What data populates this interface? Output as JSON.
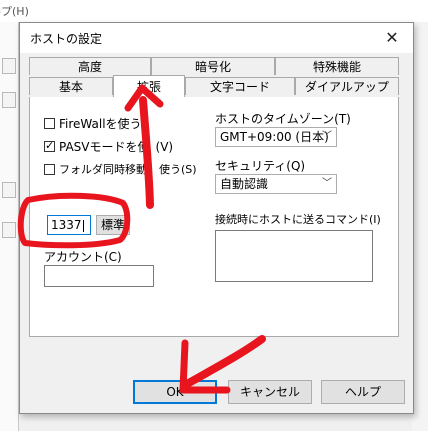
{
  "background": {
    "title_fragment": "ルプ(H)"
  },
  "dialog": {
    "title": "ホストの設定",
    "close_glyph": "✕"
  },
  "tabs": {
    "row_top": [
      "高度",
      "暗号化",
      "特殊機能"
    ],
    "row_bottom": [
      "基本",
      "拡張",
      "文字コード",
      "ダイアルアップ"
    ],
    "active": "拡張"
  },
  "options": {
    "firewall": {
      "label": "FireWallを使う(",
      "checked": false
    },
    "pasv": {
      "label": "PASVモードを使",
      "suffix": "(V)",
      "checked": true
    },
    "sync_move": {
      "label": "フォルダ同時移動",
      "suffix": "使う(S)",
      "checked": false
    }
  },
  "port": {
    "value": "1337",
    "default_button": "標準"
  },
  "account": {
    "label": "アカウント(C)",
    "value": ""
  },
  "timezone": {
    "label": "ホストのタイムゾーン(T)",
    "value": "GMT+09:00 (日本)"
  },
  "security": {
    "label": "セキュリティ(Q)",
    "value": "自動認識"
  },
  "command": {
    "label": "接続時にホストに送るコマンド(I)",
    "value": ""
  },
  "buttons": {
    "ok": "OK",
    "cancel": "キャンセル",
    "help": "ヘルプ"
  },
  "colors": {
    "annotation_red": "#e8141e",
    "focus_blue": "#0078d7"
  }
}
